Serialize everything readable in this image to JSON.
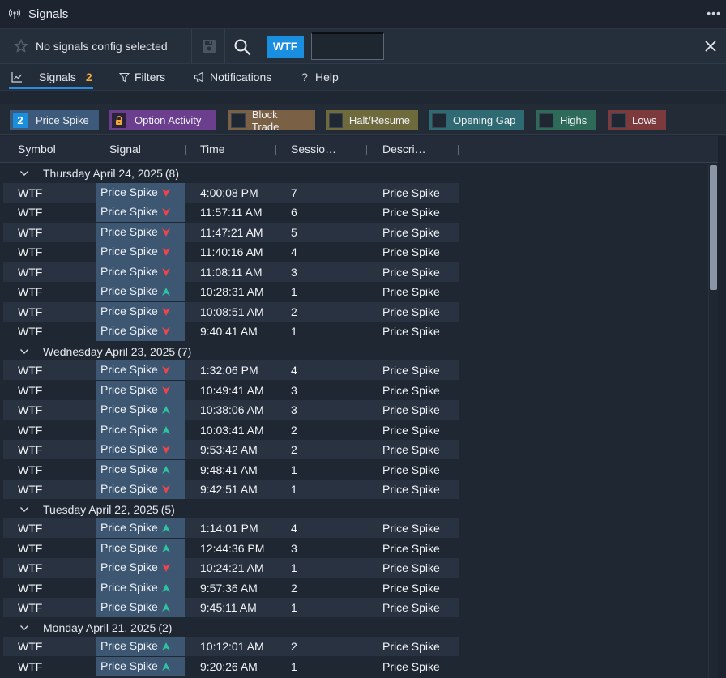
{
  "window": {
    "title": "Signals",
    "title_icon": "broadcast-icon",
    "more_label": "•••"
  },
  "toolbar": {
    "config_label": "No signals config selected",
    "symbol_chip": "WTF",
    "symbol_input_value": ""
  },
  "tabs": [
    {
      "label": "Signals",
      "badge": "2",
      "icon": "chart-line-icon"
    },
    {
      "label": "Filters",
      "icon": "filter-icon"
    },
    {
      "label": "Notifications",
      "icon": "megaphone-icon"
    },
    {
      "label": "Help",
      "icon": "question-icon"
    }
  ],
  "chips": [
    {
      "label": "Price Spike",
      "count": "2",
      "color": "#3e5a7a",
      "state": "count"
    },
    {
      "label": "Option Activity",
      "color": "#6c3f8e",
      "state": "locked"
    },
    {
      "label": "Block Trade",
      "color": "#7a6044",
      "state": "off"
    },
    {
      "label": "Halt/Resume",
      "color": "#6e6a3c",
      "state": "off"
    },
    {
      "label": "Opening Gap",
      "color": "#2f6a72",
      "state": "off"
    },
    {
      "label": "Highs",
      "color": "#2d6a58",
      "state": "off"
    },
    {
      "label": "Lows",
      "color": "#7c3a3d",
      "state": "off"
    }
  ],
  "columns": [
    "Symbol",
    "Signal",
    "Time",
    "Sessio…",
    "Descri…"
  ],
  "colors": {
    "up": "#2ec4a0",
    "down": "#f0444c",
    "signal_bg": "#3d5773",
    "accent": "#1a8fe0"
  },
  "groups": [
    {
      "label": "Thursday April 24, 2025",
      "count": "(8)",
      "rows": [
        {
          "symbol": "WTF",
          "signal": "Price Spike",
          "dir": "down",
          "time": "4:00:08 PM",
          "session": "7",
          "desc": "Price Spike"
        },
        {
          "symbol": "WTF",
          "signal": "Price Spike",
          "dir": "down",
          "time": "11:57:11 AM",
          "session": "6",
          "desc": "Price Spike"
        },
        {
          "symbol": "WTF",
          "signal": "Price Spike",
          "dir": "down",
          "time": "11:47:21 AM",
          "session": "5",
          "desc": "Price Spike"
        },
        {
          "symbol": "WTF",
          "signal": "Price Spike",
          "dir": "down",
          "time": "11:40:16 AM",
          "session": "4",
          "desc": "Price Spike"
        },
        {
          "symbol": "WTF",
          "signal": "Price Spike",
          "dir": "down",
          "time": "11:08:11 AM",
          "session": "3",
          "desc": "Price Spike"
        },
        {
          "symbol": "WTF",
          "signal": "Price Spike",
          "dir": "up",
          "time": "10:28:31 AM",
          "session": "1",
          "desc": "Price Spike"
        },
        {
          "symbol": "WTF",
          "signal": "Price Spike",
          "dir": "down",
          "time": "10:08:51 AM",
          "session": "2",
          "desc": "Price Spike"
        },
        {
          "symbol": "WTF",
          "signal": "Price Spike",
          "dir": "down",
          "time": "9:40:41 AM",
          "session": "1",
          "desc": "Price Spike"
        }
      ]
    },
    {
      "label": "Wednesday April 23, 2025",
      "count": "(7)",
      "rows": [
        {
          "symbol": "WTF",
          "signal": "Price Spike",
          "dir": "down",
          "time": "1:32:06 PM",
          "session": "4",
          "desc": "Price Spike"
        },
        {
          "symbol": "WTF",
          "signal": "Price Spike",
          "dir": "down",
          "time": "10:49:41 AM",
          "session": "3",
          "desc": "Price Spike"
        },
        {
          "symbol": "WTF",
          "signal": "Price Spike",
          "dir": "up",
          "time": "10:38:06 AM",
          "session": "3",
          "desc": "Price Spike"
        },
        {
          "symbol": "WTF",
          "signal": "Price Spike",
          "dir": "up",
          "time": "10:03:41 AM",
          "session": "2",
          "desc": "Price Spike"
        },
        {
          "symbol": "WTF",
          "signal": "Price Spike",
          "dir": "down",
          "time": "9:53:42 AM",
          "session": "2",
          "desc": "Price Spike"
        },
        {
          "symbol": "WTF",
          "signal": "Price Spike",
          "dir": "up",
          "time": "9:48:41 AM",
          "session": "1",
          "desc": "Price Spike"
        },
        {
          "symbol": "WTF",
          "signal": "Price Spike",
          "dir": "down",
          "time": "9:42:51 AM",
          "session": "1",
          "desc": "Price Spike"
        }
      ]
    },
    {
      "label": "Tuesday April 22, 2025",
      "count": "(5)",
      "rows": [
        {
          "symbol": "WTF",
          "signal": "Price Spike",
          "dir": "up",
          "time": "1:14:01 PM",
          "session": "4",
          "desc": "Price Spike"
        },
        {
          "symbol": "WTF",
          "signal": "Price Spike",
          "dir": "up",
          "time": "12:44:36 PM",
          "session": "3",
          "desc": "Price Spike"
        },
        {
          "symbol": "WTF",
          "signal": "Price Spike",
          "dir": "down",
          "time": "10:24:21 AM",
          "session": "1",
          "desc": "Price Spike"
        },
        {
          "symbol": "WTF",
          "signal": "Price Spike",
          "dir": "up",
          "time": "9:57:36 AM",
          "session": "2",
          "desc": "Price Spike"
        },
        {
          "symbol": "WTF",
          "signal": "Price Spike",
          "dir": "up",
          "time": "9:45:11 AM",
          "session": "1",
          "desc": "Price Spike"
        }
      ]
    },
    {
      "label": "Monday April 21, 2025",
      "count": "(2)",
      "rows": [
        {
          "symbol": "WTF",
          "signal": "Price Spike",
          "dir": "up",
          "time": "10:12:01 AM",
          "session": "2",
          "desc": "Price Spike"
        },
        {
          "symbol": "WTF",
          "signal": "Price Spike",
          "dir": "up",
          "time": "9:20:26 AM",
          "session": "1",
          "desc": "Price Spike"
        }
      ]
    }
  ]
}
